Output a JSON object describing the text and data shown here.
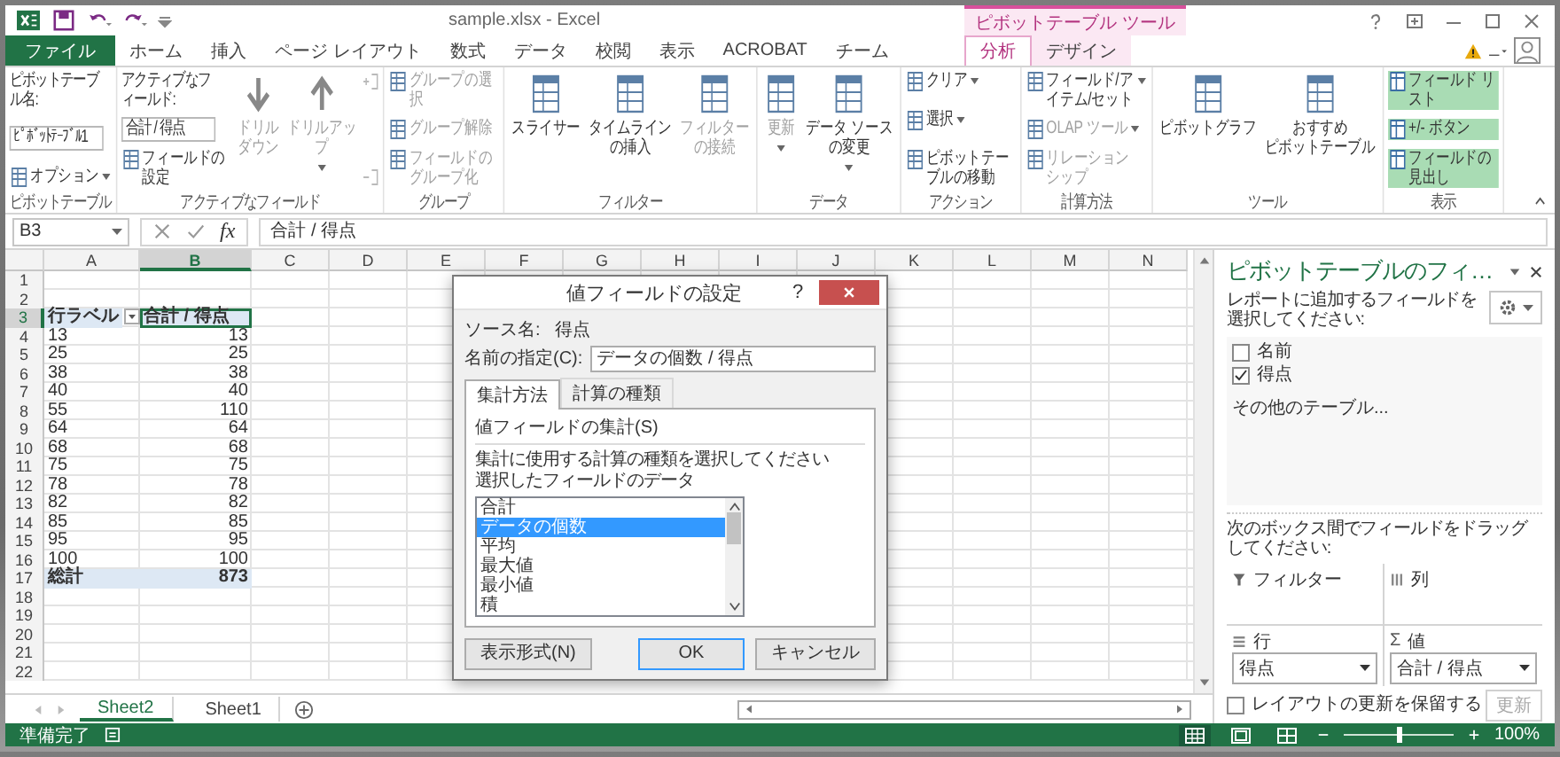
{
  "window": {
    "title": "sample.xlsx - Excel",
    "context_header": "ピボットテーブル ツール"
  },
  "tabs": [
    {
      "label": "ファイル",
      "kind": "file",
      "selected": false
    },
    {
      "label": "ホーム",
      "kind": "normal",
      "selected": false
    },
    {
      "label": "挿入",
      "kind": "normal",
      "selected": false
    },
    {
      "label": "ページ レイアウト",
      "kind": "normal",
      "selected": false
    },
    {
      "label": "数式",
      "kind": "normal",
      "selected": false
    },
    {
      "label": "データ",
      "kind": "normal",
      "selected": false
    },
    {
      "label": "校閲",
      "kind": "normal",
      "selected": false
    },
    {
      "label": "表示",
      "kind": "normal",
      "selected": false
    },
    {
      "label": "ACROBAT",
      "kind": "normal",
      "selected": false
    },
    {
      "label": "チーム",
      "kind": "normal",
      "selected": false
    },
    {
      "label": "分析",
      "kind": "context",
      "selected": true
    },
    {
      "label": "デザイン",
      "kind": "context",
      "selected": false
    }
  ],
  "ribbon": {
    "groups": [
      {
        "label": "ピボットテーブル",
        "columns": [
          [
            {
              "kind": "label",
              "text": "ピボットテーブル名:"
            },
            {
              "kind": "field",
              "value": "ﾋﾟﾎﾞｯﾄﾃｰﾌﾞﾙ1"
            },
            {
              "kind": "small",
              "label": "オプション",
              "dropdown": true,
              "disabled": false
            }
          ]
        ]
      },
      {
        "label": "アクティブなフィールド",
        "columns": [
          [
            {
              "kind": "label",
              "text": "アクティブなフィールド:"
            },
            {
              "kind": "field",
              "value": "合計 / 得点"
            },
            {
              "kind": "small",
              "label": "フィールドの設定",
              "dropdown": false,
              "disabled": false
            }
          ],
          [
            {
              "kind": "drill_down",
              "lines": [
                "ドリル",
                "ダウン"
              ],
              "dropdown": false,
              "disabled": true
            }
          ],
          [
            {
              "kind": "drill_up",
              "lines": [
                "ドリルアッ",
                "プ"
              ],
              "dropdown": true,
              "disabled": true
            }
          ],
          [
            {
              "kind": "expand",
              "disabled": true
            },
            {
              "kind": "collapse",
              "disabled": true
            }
          ]
        ]
      },
      {
        "label": "グループ",
        "columns": [
          [
            {
              "kind": "small",
              "label": "グループの選択",
              "dropdown": false,
              "disabled": true
            },
            {
              "kind": "small",
              "label": "グループ解除",
              "dropdown": false,
              "disabled": true
            },
            {
              "kind": "small",
              "label": "フィールドのグループ化",
              "dropdown": false,
              "disabled": true
            }
          ]
        ]
      },
      {
        "label": "フィルター",
        "columns": [
          [
            {
              "kind": "large",
              "lines": [
                "スライサー"
              ],
              "dropdown": false,
              "disabled": false
            }
          ],
          [
            {
              "kind": "large",
              "lines": [
                "タイムライン",
                "の挿入"
              ],
              "dropdown": false,
              "disabled": false
            }
          ],
          [
            {
              "kind": "large",
              "lines": [
                "フィルター",
                "の接続"
              ],
              "dropdown": false,
              "disabled": true
            }
          ]
        ]
      },
      {
        "label": "データ",
        "columns": [
          [
            {
              "kind": "large",
              "lines": [
                "更新"
              ],
              "dropdown": true,
              "disabled": true
            }
          ],
          [
            {
              "kind": "large",
              "lines": [
                "データ ソース",
                "の変更"
              ],
              "dropdown": true,
              "disabled": false
            }
          ]
        ]
      },
      {
        "label": "アクション",
        "columns": [
          [
            {
              "kind": "small",
              "label": "クリア",
              "dropdown": true,
              "disabled": false
            },
            {
              "kind": "small",
              "label": "選択",
              "dropdown": true,
              "disabled": false
            },
            {
              "kind": "small",
              "label": "ピボットテーブルの移動",
              "dropdown": false,
              "disabled": false
            }
          ]
        ]
      },
      {
        "label": "計算方法",
        "columns": [
          [
            {
              "kind": "small",
              "label": "フィールド/アイテム/セット",
              "dropdown": true,
              "disabled": false
            },
            {
              "kind": "small",
              "label": "OLAP ツール",
              "dropdown": true,
              "disabled": true
            },
            {
              "kind": "small",
              "label": "リレーションシップ",
              "dropdown": false,
              "disabled": true
            }
          ]
        ]
      },
      {
        "label": "ツール",
        "columns": [
          [
            {
              "kind": "large",
              "lines": [
                "ピボットグラフ"
              ],
              "dropdown": false,
              "disabled": false
            }
          ],
          [
            {
              "kind": "large",
              "lines": [
                "おすすめ",
                "ピボットテーブル"
              ],
              "dropdown": false,
              "disabled": false
            }
          ]
        ]
      },
      {
        "label": "表示",
        "columns": [
          [
            {
              "kind": "toggle",
              "label": "フィールド リスト",
              "on": true
            },
            {
              "kind": "toggle",
              "label": "+/- ボタン",
              "on": true
            },
            {
              "kind": "toggle",
              "label": "フィールドの見出し",
              "on": true
            }
          ]
        ]
      }
    ]
  },
  "formula_bar": {
    "name_box": "B3",
    "function_button": "fx",
    "formula": "合計 / 得点"
  },
  "sheet": {
    "columns": [
      {
        "label": "A",
        "selected": false
      },
      {
        "label": "B",
        "selected": true
      },
      {
        "label": "C",
        "selected": false
      },
      {
        "label": "D",
        "selected": false
      },
      {
        "label": "E",
        "selected": false
      },
      {
        "label": "F",
        "selected": false
      },
      {
        "label": "G",
        "selected": false
      },
      {
        "label": "H",
        "selected": false
      },
      {
        "label": "I",
        "selected": false
      },
      {
        "label": "J",
        "selected": false
      },
      {
        "label": "K",
        "selected": false
      },
      {
        "label": "L",
        "selected": false
      },
      {
        "label": "M",
        "selected": false
      },
      {
        "label": "N",
        "selected": false
      }
    ],
    "rows": [
      {
        "number": "1",
        "selected": false
      },
      {
        "number": "2",
        "selected": false
      },
      {
        "number": "3",
        "selected": true,
        "cells": [
          {
            "text": "行ラベル",
            "kind": "header",
            "filter": true,
            "active": false
          },
          {
            "text": "合計 / 得点",
            "kind": "header",
            "filter": false,
            "active": true
          }
        ]
      },
      {
        "number": "4",
        "selected": false,
        "cells": [
          {
            "text": "13",
            "kind": "label",
            "active": false
          },
          {
            "text": "13",
            "kind": "value",
            "active": false
          }
        ]
      },
      {
        "number": "5",
        "selected": false,
        "cells": [
          {
            "text": "25",
            "kind": "label",
            "active": false
          },
          {
            "text": "25",
            "kind": "value",
            "active": false
          }
        ]
      },
      {
        "number": "6",
        "selected": false,
        "cells": [
          {
            "text": "38",
            "kind": "label",
            "active": false
          },
          {
            "text": "38",
            "kind": "value",
            "active": false
          }
        ]
      },
      {
        "number": "7",
        "selected": false,
        "cells": [
          {
            "text": "40",
            "kind": "label",
            "active": false
          },
          {
            "text": "40",
            "kind": "value",
            "active": false
          }
        ]
      },
      {
        "number": "8",
        "selected": false,
        "cells": [
          {
            "text": "55",
            "kind": "label",
            "active": false
          },
          {
            "text": "110",
            "kind": "value",
            "active": false
          }
        ]
      },
      {
        "number": "9",
        "selected": false,
        "cells": [
          {
            "text": "64",
            "kind": "label",
            "active": false
          },
          {
            "text": "64",
            "kind": "value",
            "active": false
          }
        ]
      },
      {
        "number": "10",
        "selected": false,
        "cells": [
          {
            "text": "68",
            "kind": "label",
            "active": false
          },
          {
            "text": "68",
            "kind": "value",
            "active": false
          }
        ]
      },
      {
        "number": "11",
        "selected": false,
        "cells": [
          {
            "text": "75",
            "kind": "label",
            "active": false
          },
          {
            "text": "75",
            "kind": "value",
            "active": false
          }
        ]
      },
      {
        "number": "12",
        "selected": false,
        "cells": [
          {
            "text": "78",
            "kind": "label",
            "active": false
          },
          {
            "text": "78",
            "kind": "value",
            "active": false
          }
        ]
      },
      {
        "number": "13",
        "selected": false,
        "cells": [
          {
            "text": "82",
            "kind": "label",
            "active": false
          },
          {
            "text": "82",
            "kind": "value",
            "active": false
          }
        ]
      },
      {
        "number": "14",
        "selected": false,
        "cells": [
          {
            "text": "85",
            "kind": "label",
            "active": false
          },
          {
            "text": "85",
            "kind": "value",
            "active": false
          }
        ]
      },
      {
        "number": "15",
        "selected": false,
        "cells": [
          {
            "text": "95",
            "kind": "label",
            "active": false
          },
          {
            "text": "95",
            "kind": "value",
            "active": false
          }
        ]
      },
      {
        "number": "16",
        "selected": false,
        "cells": [
          {
            "text": "100",
            "kind": "label",
            "active": false
          },
          {
            "text": "100",
            "kind": "value",
            "active": false
          }
        ]
      },
      {
        "number": "17",
        "selected": false,
        "cells": [
          {
            "text": "総計",
            "kind": "total_label",
            "active": false
          },
          {
            "text": "873",
            "kind": "total_value",
            "active": false
          }
        ]
      },
      {
        "number": "18",
        "selected": false
      },
      {
        "number": "19",
        "selected": false
      },
      {
        "number": "20",
        "selected": false
      },
      {
        "number": "21",
        "selected": false
      },
      {
        "number": "22",
        "selected": false
      }
    ],
    "tabs": [
      {
        "label": "Sheet2",
        "selected": true
      },
      {
        "label": "Sheet1",
        "selected": false
      }
    ]
  },
  "dialog": {
    "title": "値フィールドの設定",
    "help": "?",
    "source_label": "ソース名:",
    "source_value": "得点",
    "name_label": "名前の指定(C):",
    "name_value": "データの個数 / 得点",
    "tabs": [
      {
        "label": "集計方法",
        "selected": true
      },
      {
        "label": "計算の種類",
        "selected": false
      }
    ],
    "section": "値フィールドの集計(S)",
    "instruction": "集計に使用する計算の種類を選択してください",
    "list_label": "選択したフィールドのデータ",
    "options": [
      {
        "label": "合計",
        "selected": false
      },
      {
        "label": "データの個数",
        "selected": true
      },
      {
        "label": "平均",
        "selected": false
      },
      {
        "label": "最大値",
        "selected": false
      },
      {
        "label": "最小値",
        "selected": false
      },
      {
        "label": "積",
        "selected": false
      }
    ],
    "buttons": [
      {
        "label": "表示形式(N)",
        "kind": "left"
      },
      {
        "label": "OK",
        "kind": "default"
      },
      {
        "label": "キャンセル",
        "kind": "normal"
      }
    ]
  },
  "pane": {
    "title": "ピボットテーブルのフィ…",
    "instruction": "レポートに追加するフィールドを選択してください:",
    "fields": [
      {
        "label": "名前",
        "checked": false
      },
      {
        "label": "得点",
        "checked": true
      }
    ],
    "more_tables": "その他のテーブル...",
    "drag_instruction": "次のボックス間でフィールドをドラッグしてください:",
    "areas": [
      {
        "kind": "filter",
        "label": "フィルター"
      },
      {
        "kind": "columns",
        "label": "列"
      },
      {
        "kind": "rows",
        "label": "行",
        "chip": "得点"
      },
      {
        "kind": "values",
        "label": "値",
        "symbol": "Σ",
        "chip": "合計 / 得点"
      }
    ],
    "defer": {
      "label": "レイアウトの更新を保留する",
      "checked": false
    },
    "update": {
      "label": "更新",
      "disabled": true
    }
  },
  "status_bar": {
    "text": "準備完了",
    "views": [
      {
        "selected": true
      },
      {
        "selected": false
      },
      {
        "selected": false
      }
    ],
    "zoom": {
      "level": 0.5,
      "reading": "100%"
    }
  }
}
